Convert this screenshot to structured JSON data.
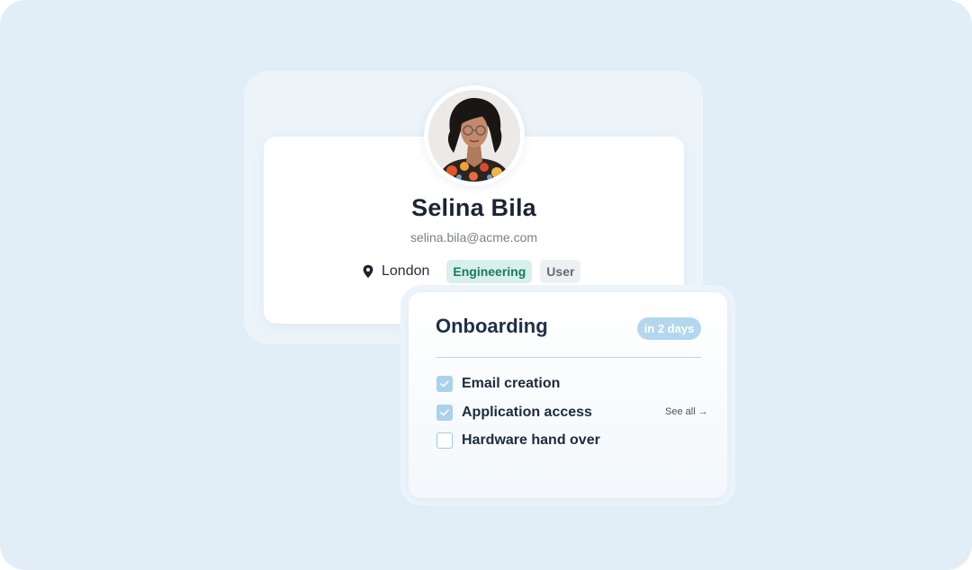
{
  "profile": {
    "name": "Selina Bila",
    "email": "selina.bila@acme.com",
    "location": "London",
    "avatar_alt": "Profile photo",
    "tags": [
      {
        "label": "Engineering",
        "color": "#1a7a5a",
        "background": "#d8f0ea"
      },
      {
        "label": "User",
        "color": "#646b77",
        "background": "#eef0f3"
      }
    ]
  },
  "onboarding": {
    "title": "Onboarding",
    "due_badge": "in 2 days",
    "see_all": "See all →",
    "tasks": [
      {
        "label": "Email creation",
        "done": true
      },
      {
        "label": "Application access",
        "done": true
      },
      {
        "label": "Hardware hand over",
        "done": false
      }
    ]
  },
  "colors": {
    "background": "#e2eef7",
    "accent": "#a9d2ec",
    "text_primary": "#1d2433"
  },
  "icons": {
    "location": "map-pin-icon",
    "check": "check-icon"
  }
}
